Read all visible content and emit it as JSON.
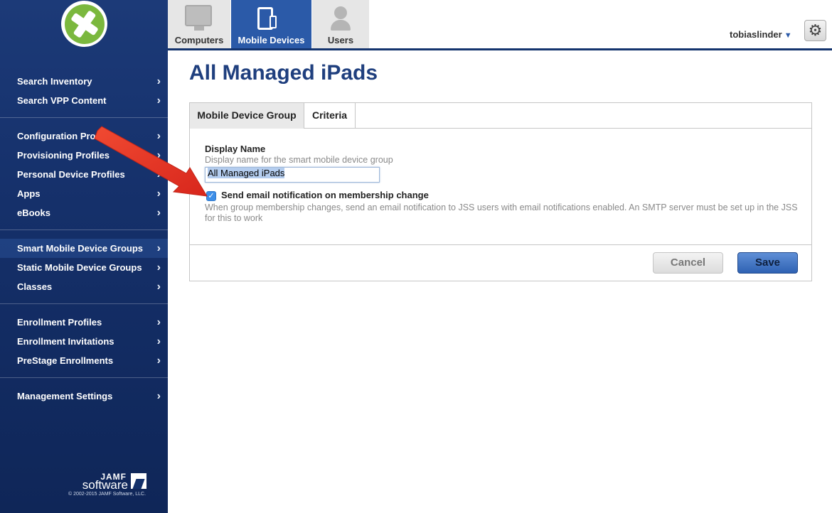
{
  "sidebar": {
    "groups": [
      {
        "items": [
          {
            "label": "Search Inventory"
          },
          {
            "label": "Search VPP Content"
          }
        ]
      },
      {
        "items": [
          {
            "label": "Configuration Profiles"
          },
          {
            "label": "Provisioning Profiles"
          },
          {
            "label": "Personal Device Profiles"
          },
          {
            "label": "Apps"
          },
          {
            "label": "eBooks"
          }
        ]
      },
      {
        "items": [
          {
            "label": "Smart Mobile Device Groups",
            "active": true
          },
          {
            "label": "Static Mobile Device Groups"
          },
          {
            "label": "Classes"
          }
        ]
      },
      {
        "items": [
          {
            "label": "Enrollment Profiles"
          },
          {
            "label": "Enrollment Invitations"
          },
          {
            "label": "PreStage Enrollments"
          }
        ]
      },
      {
        "items": [
          {
            "label": "Management Settings"
          }
        ]
      }
    ],
    "footer": {
      "brand_top": "JAMF",
      "brand_bottom": "software",
      "copyright": "© 2002-2015 JAMF Software, LLC."
    }
  },
  "topnav": {
    "tabs": [
      {
        "label": "Computers",
        "icon": "computer-icon"
      },
      {
        "label": "Mobile Devices",
        "icon": "mobile-devices-icon",
        "active": true
      },
      {
        "label": "Users",
        "icon": "user-icon"
      }
    ],
    "username": "tobiaslinder",
    "caret": "▼",
    "gear": "⚙"
  },
  "main": {
    "title": "All Managed iPads",
    "tabs": [
      {
        "label": "Mobile Device Group",
        "active": true
      },
      {
        "label": "Criteria"
      }
    ],
    "display_name": {
      "label": "Display Name",
      "help": "Display name for the smart mobile device group",
      "value": "All Managed iPads"
    },
    "notification": {
      "checked": true,
      "check_glyph": "✓",
      "label": "Send email notification on membership change",
      "help": "When group membership changes, send an email notification to JSS users with email notifications enabled. An SMTP server must be set up in the JSS for this to work"
    },
    "buttons": {
      "cancel": "Cancel",
      "save": "Save"
    }
  },
  "colors": {
    "sidebar": "#15306a",
    "accent": "#2b5aa8",
    "title": "#1f3f7e",
    "annotation_arrow": "#e8392b",
    "logo_green": "#7bb83e"
  }
}
